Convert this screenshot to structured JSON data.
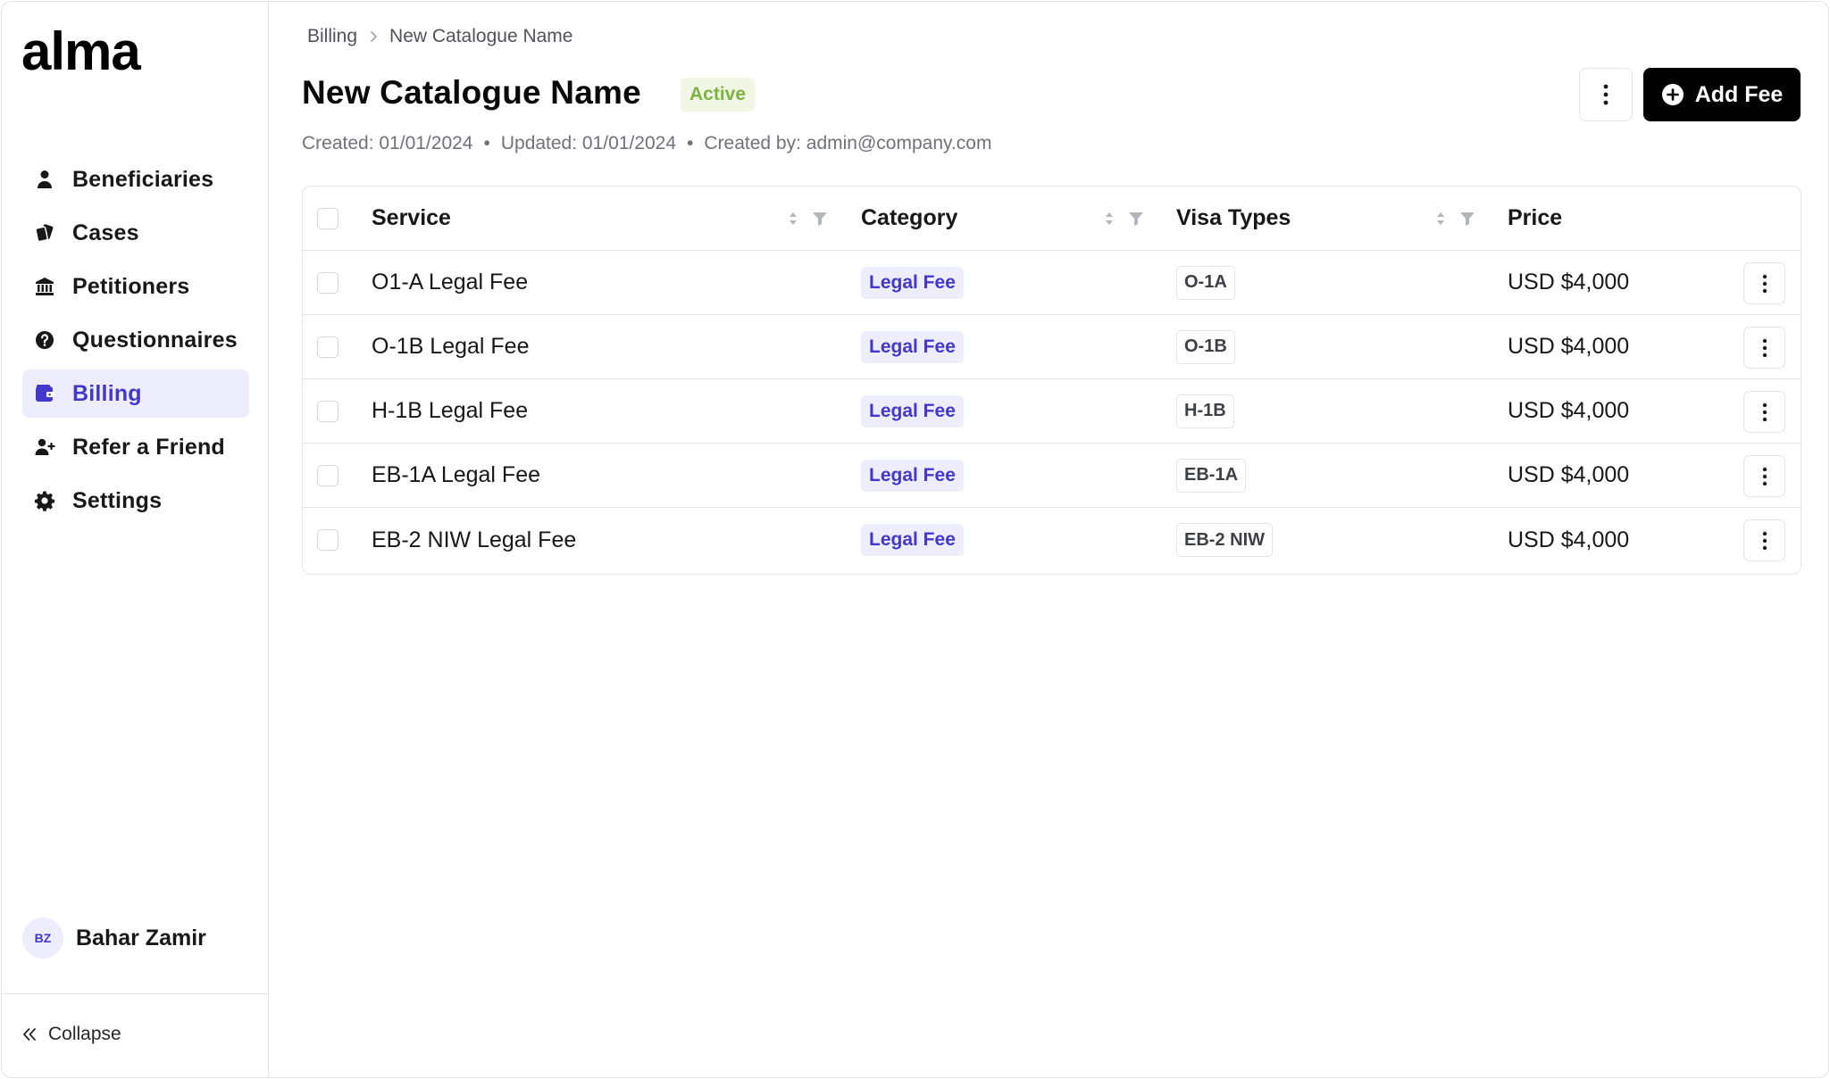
{
  "app": {
    "logo_text": "alma"
  },
  "sidebar": {
    "items": [
      {
        "label": "Beneficiaries",
        "icon": "person-icon",
        "active": false
      },
      {
        "label": "Cases",
        "icon": "cases-icon",
        "active": false
      },
      {
        "label": "Petitioners",
        "icon": "bank-icon",
        "active": false
      },
      {
        "label": "Questionnaires",
        "icon": "question-circle-icon",
        "active": false
      },
      {
        "label": "Billing",
        "icon": "wallet-icon",
        "active": true
      },
      {
        "label": "Refer a Friend",
        "icon": "user-plus-icon",
        "active": false
      },
      {
        "label": "Settings",
        "icon": "gear-icon",
        "active": false
      }
    ],
    "user": {
      "initials": "BZ",
      "name": "Bahar Zamir"
    },
    "collapse_label": "Collapse"
  },
  "breadcrumb": {
    "parent": "Billing",
    "current": "New Catalogue Name"
  },
  "header": {
    "title": "New Catalogue Name",
    "status": "Active",
    "created": "Created: 01/01/2024",
    "updated": "Updated: 01/01/2024",
    "created_by": "Created by: admin@company.com",
    "add_fee_label": "Add Fee"
  },
  "table": {
    "columns": {
      "service": "Service",
      "category": "Category",
      "visa_types": "Visa Types",
      "price": "Price"
    },
    "rows": [
      {
        "service": "O1-A Legal Fee",
        "category": "Legal Fee",
        "visa": "O-1A",
        "price": "USD $4,000"
      },
      {
        "service": "O-1B Legal Fee",
        "category": "Legal Fee",
        "visa": "O-1B",
        "price": "USD $4,000"
      },
      {
        "service": "H-1B Legal Fee",
        "category": "Legal Fee",
        "visa": "H-1B",
        "price": "USD $4,000"
      },
      {
        "service": "EB-1A Legal Fee",
        "category": "Legal Fee",
        "visa": "EB-1A",
        "price": "USD $4,000"
      },
      {
        "service": "EB-2 NIW Legal Fee",
        "category": "Legal Fee",
        "visa": "EB-2 NIW",
        "price": "USD $4,000"
      }
    ]
  },
  "colors": {
    "accent": "#4338ca",
    "accent_bg": "#eeedfd",
    "status_green": "#7cb342",
    "status_green_bg": "#f1f7e4",
    "border": "#e4e4e7"
  }
}
